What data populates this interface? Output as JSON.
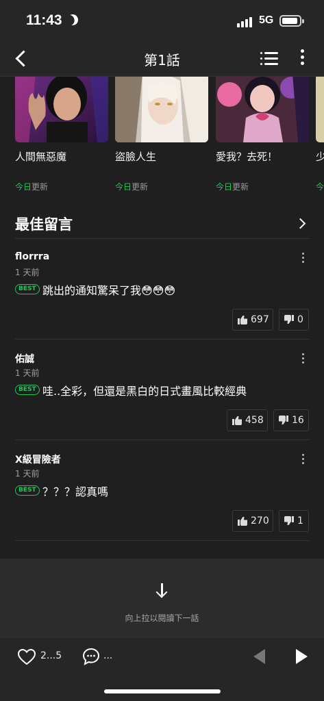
{
  "status_bar": {
    "time": "11:43",
    "network": "5G"
  },
  "header": {
    "title": "第1話"
  },
  "recommendations": [
    {
      "title": "人間無惡魔",
      "update_highlight": "今日",
      "update_rest": "更新"
    },
    {
      "title": "盜臉人生",
      "update_highlight": "今日",
      "update_rest": "更新"
    },
    {
      "title": "愛我？去死！",
      "update_highlight": "今日",
      "update_rest": "更新"
    },
    {
      "title": "少",
      "update_highlight": "今",
      "update_rest": ""
    }
  ],
  "best_comments": {
    "section_title": "最佳留言",
    "items": [
      {
        "author": "florrra",
        "time": "1 天前",
        "badge": "BEST",
        "text": "跳出的通知驚呆了我😳😳😳",
        "likes": "697",
        "dislikes": "0"
      },
      {
        "author": "佑誠",
        "time": "1 天前",
        "badge": "BEST",
        "text": "哇..全彩，但還是黑白的日式畫風比較經典",
        "likes": "458",
        "dislikes": "16"
      },
      {
        "author": "X級冒險者",
        "time": "1 天前",
        "badge": "BEST",
        "text": "？？？認真嗎",
        "likes": "270",
        "dislikes": "1"
      }
    ]
  },
  "next_episode": {
    "hint": "向上拉以閱讀下一話"
  },
  "bottom_bar": {
    "like_count": "2...5",
    "comment_count": "..."
  },
  "colors": {
    "accent_green": "#1ec95a",
    "background": "#1f1f1f",
    "bar": "#262626"
  }
}
